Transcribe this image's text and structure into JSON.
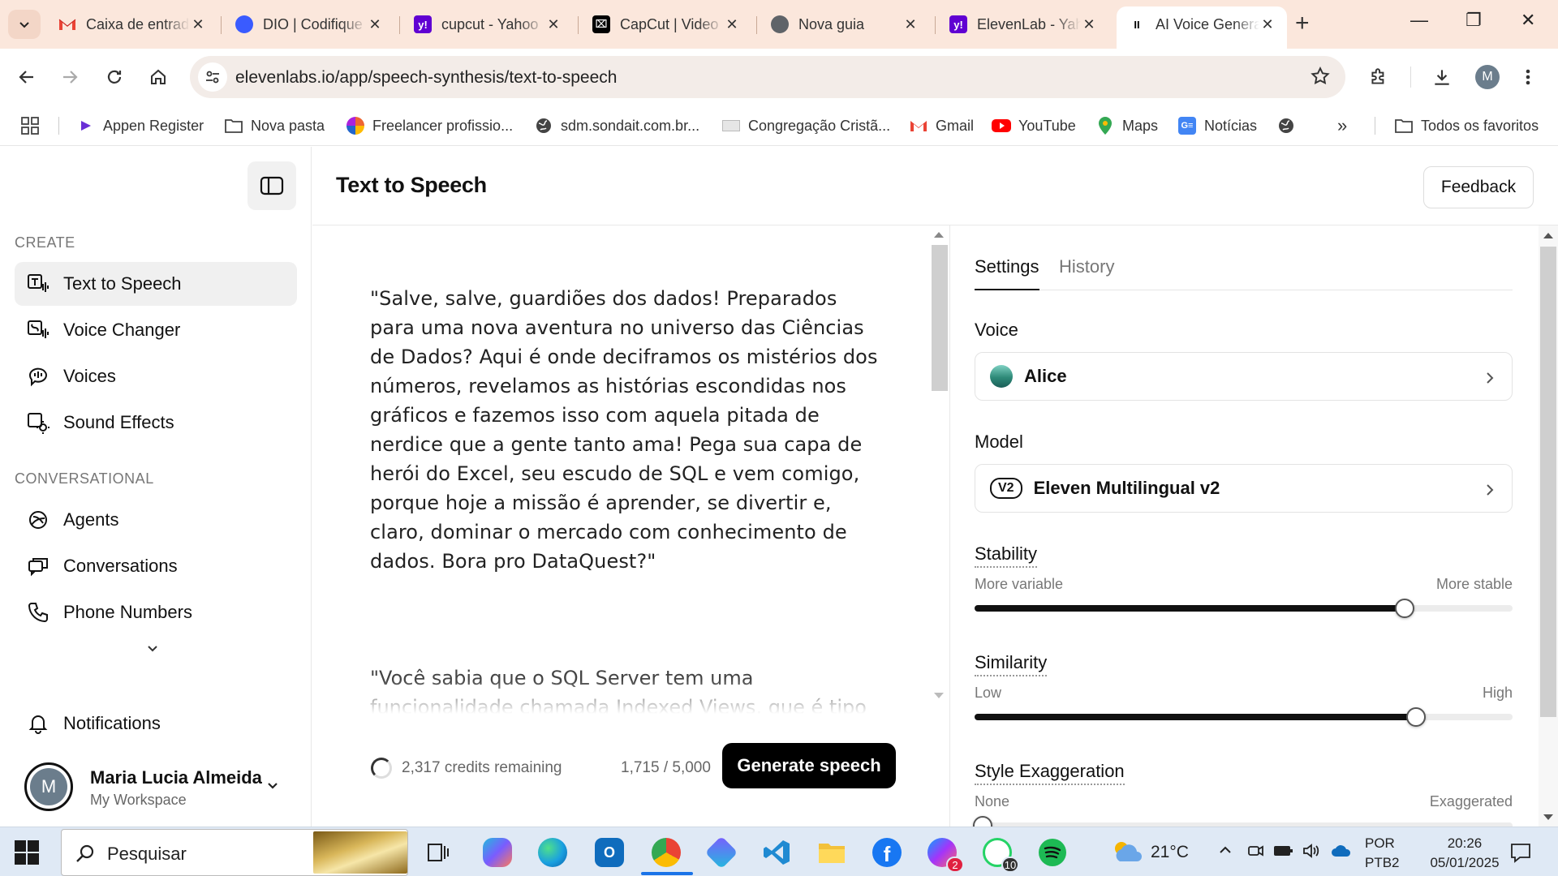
{
  "browser": {
    "tabs": [
      {
        "title": "Caixa de entrada",
        "favicon": "gmail-icon",
        "color": "#ea4335"
      },
      {
        "title": "DIO | Codifique",
        "favicon": "dio-icon",
        "color": "#3a5bff"
      },
      {
        "title": "cupcut - Yahoo",
        "favicon": "yahoo-icon",
        "color": "#6001d2"
      },
      {
        "title": "CapCut | Video",
        "favicon": "capcut-icon",
        "color": "#000000"
      },
      {
        "title": "Nova guia",
        "favicon": "globe-icon",
        "color": "#5f6368"
      },
      {
        "title": "ElevenLab - Yahoo",
        "favicon": "yahoo-icon",
        "color": "#6001d2"
      },
      {
        "title": "AI Voice Generator",
        "favicon": "elevenlabs-icon",
        "color": "#000000",
        "active": true
      }
    ],
    "url": "elevenlabs.io/app/speech-synthesis/text-to-speech",
    "profile_initial": "M",
    "bookmarks": [
      {
        "label": "Appen Register",
        "icon": "appen-icon"
      },
      {
        "label": "Nova pasta",
        "icon": "folder-icon"
      },
      {
        "label": "Freelancer profissio...",
        "icon": "freelancer-icon"
      },
      {
        "label": "sdm.sondait.com.br...",
        "icon": "globe-icon"
      },
      {
        "label": "Congregação Cristã...",
        "icon": "ccb-icon"
      },
      {
        "label": "Gmail",
        "icon": "gmail-icon"
      },
      {
        "label": "YouTube",
        "icon": "youtube-icon"
      },
      {
        "label": "Maps",
        "icon": "maps-icon"
      },
      {
        "label": "Notícias",
        "icon": "news-icon"
      }
    ],
    "bookmarks_more": "»",
    "all_bookmarks": "Todos os favoritos"
  },
  "sidebar": {
    "section_create": "CREATE",
    "create_items": [
      {
        "label": "Text to Speech",
        "icon": "text-to-speech-icon",
        "active": true
      },
      {
        "label": "Voice Changer",
        "icon": "voice-changer-icon"
      },
      {
        "label": "Voices",
        "icon": "voices-icon"
      },
      {
        "label": "Sound Effects",
        "icon": "sound-effects-icon"
      }
    ],
    "section_conversational": "CONVERSATIONAL",
    "conv_items": [
      {
        "label": "Agents",
        "icon": "agents-icon"
      },
      {
        "label": "Conversations",
        "icon": "conversations-icon"
      },
      {
        "label": "Phone Numbers",
        "icon": "phone-icon"
      }
    ],
    "notifications": "Notifications",
    "user": {
      "initial": "M",
      "name": "Maria Lucia Almeida",
      "workspace": "My Workspace"
    }
  },
  "header": {
    "title": "Text to Speech",
    "feedback": "Feedback"
  },
  "editor": {
    "text": "\"Salve, salve, guardiões dos dados! Preparados para uma nova aventura no universo das Ciências de Dados? Aqui é onde deciframos os mistérios dos números, revelamos as histórias escondidas nos gráficos e fazemos isso com aquela pitada de nerdice que a gente tanto ama! Pega sua capa de herói do Excel, seu escudo de SQL e vem comigo, porque hoje a missão é aprender, se divertir e, claro, dominar o mercado com conhecimento de dados. Bora pro DataQuest?\"",
    "text2": "\"Você sabia que o SQL Server tem uma funcionalidade chamada Indexed Views, que é tipo a",
    "credits": "2,317 credits remaining",
    "char_count": "1,715 / 5,000",
    "generate": "Generate speech"
  },
  "settings": {
    "tab_settings": "Settings",
    "tab_history": "History",
    "voice_label": "Voice",
    "voice_value": "Alice",
    "model_label": "Model",
    "model_badge": "V2",
    "model_value": "Eleven Multilingual v2",
    "stability": {
      "label": "Stability",
      "min": "More variable",
      "max": "More stable",
      "value": 0.8
    },
    "similarity": {
      "label": "Similarity",
      "min": "Low",
      "max": "High",
      "value": 0.82
    },
    "style": {
      "label": "Style Exaggeration",
      "min": "None",
      "max": "Exaggerated",
      "value": 0.0
    }
  },
  "taskbar": {
    "search": "Pesquisar",
    "weather": "21°C",
    "lang_line1": "POR",
    "lang_line2": "PTB2",
    "time": "20:26",
    "date": "05/01/2025",
    "whatsapp_badge": "10",
    "messenger_badge": "2"
  }
}
